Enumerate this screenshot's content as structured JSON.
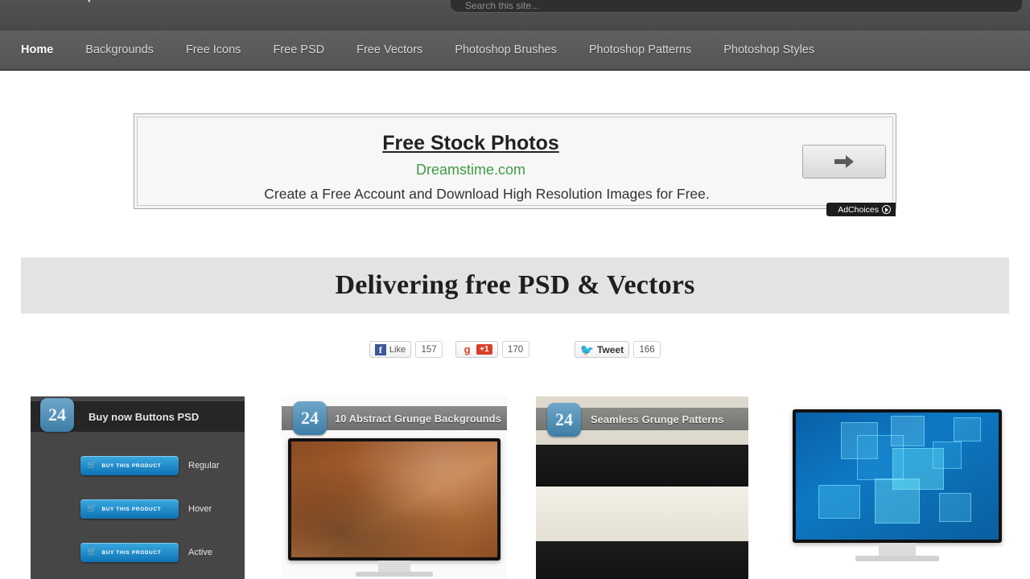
{
  "header": {
    "brand_stub": "free psd",
    "search_placeholder": "Search this site..."
  },
  "nav": {
    "items": [
      {
        "label": "Home",
        "active": true
      },
      {
        "label": "Backgrounds",
        "active": false
      },
      {
        "label": "Free Icons",
        "active": false
      },
      {
        "label": "Free PSD",
        "active": false
      },
      {
        "label": "Free Vectors",
        "active": false
      },
      {
        "label": "Photoshop Brushes",
        "active": false
      },
      {
        "label": "Photoshop Patterns",
        "active": false
      },
      {
        "label": "Photoshop Styles",
        "active": false
      }
    ]
  },
  "ad": {
    "title": "Free Stock Photos",
    "url": "Dreamstime.com",
    "description": "Create a Free Account and Download High Resolution Images for Free.",
    "arrow_icon": "right-arrow-icon",
    "adchoices_label": "AdChoices"
  },
  "section": {
    "heading": "Delivering free PSD & Vectors"
  },
  "social": {
    "facebook": {
      "icon": "facebook-icon",
      "label": "Like",
      "count": "157"
    },
    "googleplus": {
      "icon": "google-plus-icon",
      "label": "+1",
      "count": "170"
    },
    "twitter": {
      "icon": "twitter-bird-icon",
      "label": "Tweet",
      "count": "166"
    }
  },
  "cards": [
    {
      "badge": "24",
      "title": "Buy now Buttons PSD",
      "buttons": [
        {
          "text": "BUY THIS PRODUCT",
          "state": "Regular"
        },
        {
          "text": "BUY THIS PRODUCT",
          "state": "Hover"
        },
        {
          "text": "BUY THIS PRODUCT",
          "state": "Active"
        }
      ]
    },
    {
      "badge": "24",
      "title": "10 Abstract Grunge Backgrounds"
    },
    {
      "badge": "24",
      "title": "Seamless Grunge Patterns"
    },
    {
      "title": ""
    }
  ],
  "colors": {
    "nav_bg": "#5a5a5a",
    "topbar_bg": "#4b4b4b",
    "ad_url_green": "#3f9c45",
    "section_bg": "#e3e3e3",
    "badge_blue": "#3d7ea6",
    "button_blue": "#0e72b4"
  }
}
